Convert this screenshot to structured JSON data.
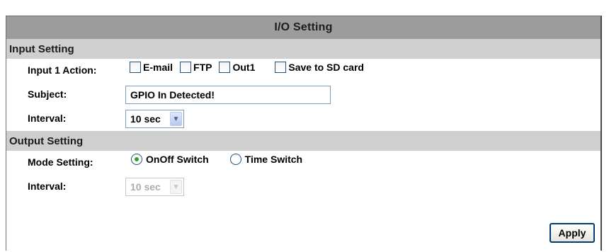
{
  "title": "I/O Setting",
  "input_section": {
    "heading": "Input Setting",
    "action_label": "Input 1 Action:",
    "actions": [
      {
        "label": "E-mail",
        "checked": false
      },
      {
        "label": "FTP",
        "checked": false
      },
      {
        "label": "Out1",
        "checked": false
      },
      {
        "label": "Save to SD card",
        "checked": false
      }
    ],
    "subject_label": "Subject:",
    "subject_value": "GPIO In Detected!",
    "interval_label": "Interval:",
    "interval_value": "10 sec"
  },
  "output_section": {
    "heading": "Output Setting",
    "mode_label": "Mode Setting:",
    "modes": [
      {
        "label": "OnOff Switch",
        "selected": true
      },
      {
        "label": "Time Switch",
        "selected": false
      }
    ],
    "interval_label": "Interval:",
    "interval_value": "10 sec",
    "interval_disabled": true
  },
  "apply_label": "Apply",
  "colors": {
    "title_bar": "#9c9c9c",
    "section_bar": "#cfcfcf",
    "radio_dot": "#2aa52a",
    "button_border": "#003c74"
  },
  "icons": {
    "dropdown": "chevron-down-icon"
  }
}
